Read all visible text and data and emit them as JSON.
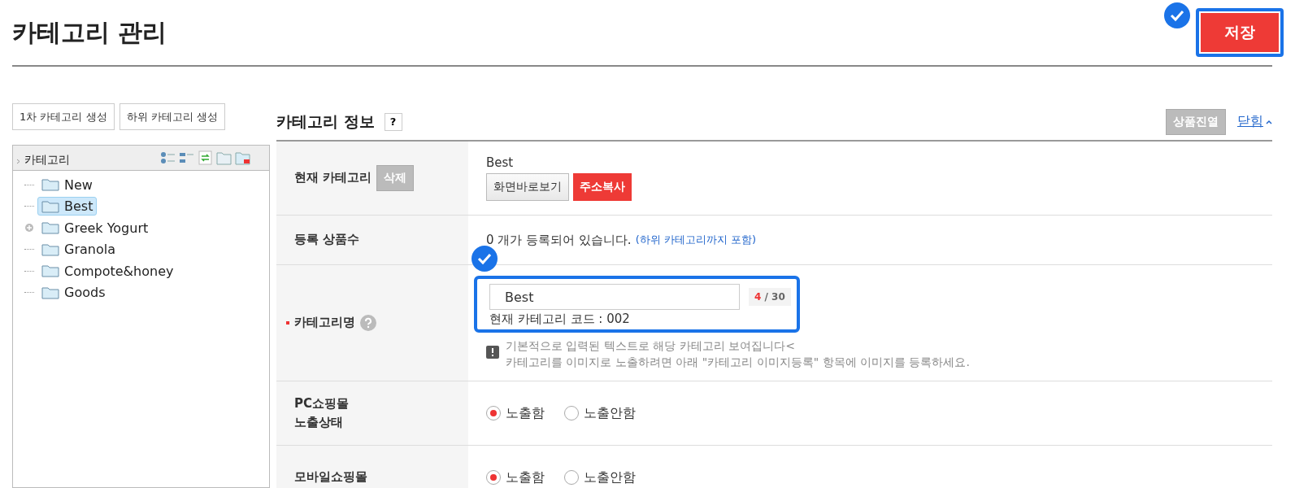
{
  "page_title": "카테고리 관리",
  "save_button": {
    "label": "저장",
    "highlighted": true
  },
  "left_buttons": [
    "1차 카테고리 생성",
    "하위 카테고리 생성"
  ],
  "tree": {
    "root": "카테고리",
    "items": [
      {
        "label": "New",
        "kind": "leaf",
        "selected": false
      },
      {
        "label": "Best",
        "kind": "leaf",
        "selected": true
      },
      {
        "label": "Greek Yogurt",
        "kind": "branch",
        "expanded": false,
        "selected": false
      },
      {
        "label": "Granola",
        "kind": "leaf",
        "selected": false
      },
      {
        "label": "Compote&honey",
        "kind": "leaf",
        "selected": false
      },
      {
        "label": "Goods",
        "kind": "leaf",
        "selected": false
      }
    ]
  },
  "section": {
    "title": "카테고리 정보",
    "help": "?",
    "display_button": "상품진열",
    "toggle_link": "닫힘"
  },
  "rows": [
    {
      "kind": "current",
      "label": "현재 카테고리",
      "delete_button": "삭제",
      "value": "Best",
      "view_button": "화면바로보기",
      "copy_button": "주소복사"
    },
    {
      "kind": "count",
      "label": "등록 상품수",
      "text": "0 개가 등록되어 있습니다.",
      "link": "(하위 카테고리까지 포함)"
    },
    {
      "kind": "name",
      "label": "카테고리명",
      "required": true,
      "value": "Best",
      "count": "4",
      "max": "/ 30",
      "code": "현재 카테고리 코드 : 002",
      "highlighted": true,
      "notes": [
        "기본적으로 입력된 텍스트로 해당 카테고리 보여집니다<",
        "카테고리를 이미지로 노출하려면 아래 \"카테고리 이미지등록\" 항목에 이미지를 등록하세요."
      ]
    },
    {
      "kind": "radio",
      "label": [
        "PC쇼핑몰",
        "노출상태"
      ],
      "options": [
        {
          "label": "노출함",
          "selected": true
        },
        {
          "label": "노출안함",
          "selected": false
        }
      ]
    },
    {
      "kind": "radio",
      "label": [
        "모바일쇼핑몰"
      ],
      "options": [
        {
          "label": "노출함",
          "selected": true
        },
        {
          "label": "노출안함",
          "selected": false
        }
      ]
    }
  ]
}
